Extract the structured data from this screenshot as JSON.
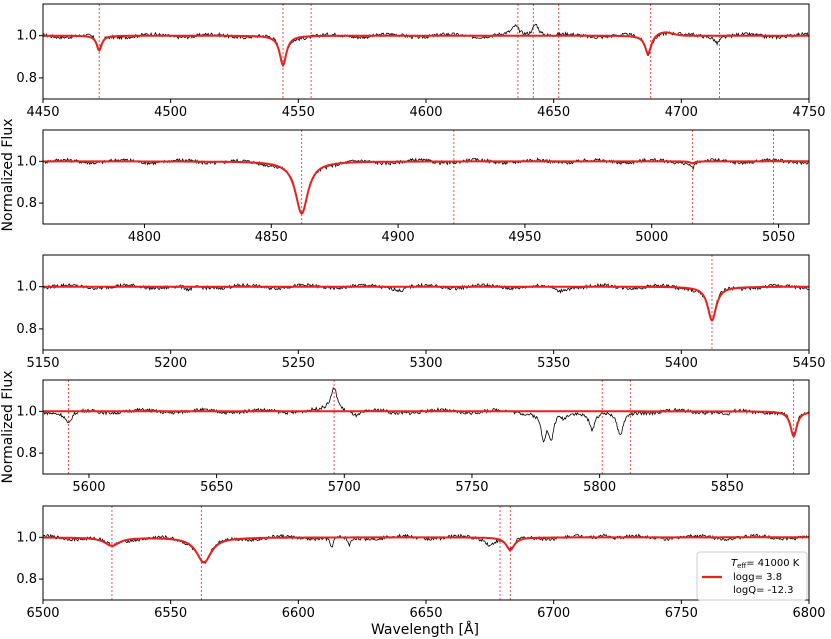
{
  "figure": {
    "ylabel_top": "Normalized Flux",
    "ylabel_bottom": "Normalized Flux",
    "xlabel": "Wavelength [Å]"
  },
  "legend": {
    "teff_label": "T",
    "teff_sub": "eff",
    "teff_value": "= 41000 K",
    "logg": "logg= 3.8",
    "logq": "logQ= -12.3",
    "line_color": "#e8211d"
  },
  "colors": {
    "observed": "#000000",
    "model": "#e8211d",
    "marker": "#e8211d"
  },
  "chart_data": [
    {
      "type": "line",
      "xlim": [
        4450,
        4750
      ],
      "ylim": [
        0.7,
        1.15
      ],
      "xticks": [
        4450,
        4500,
        4550,
        4600,
        4650,
        4700,
        4750
      ],
      "yticks": [
        0.8,
        1.0
      ],
      "xtick_labels": [
        "4450",
        "4500",
        "4550",
        "4600",
        "4650",
        "4700",
        "4750"
      ],
      "ytick_labels": [
        "0.8",
        "1.0"
      ],
      "markers": [
        4472,
        4544,
        4555,
        4636,
        4642,
        4652,
        4688,
        4715
      ],
      "lines": [
        {
          "center": 4472,
          "depth": 0.07,
          "width": 1.2
        },
        {
          "center": 4544,
          "depth": 0.14,
          "width": 1.6
        },
        {
          "center": 4687,
          "depth": 0.09,
          "width": 1.5
        }
      ],
      "emission": [
        {
          "center": 4693,
          "height": 0.02,
          "width": 5
        }
      ],
      "obs_features": [
        {
          "center": 4643,
          "height": 0.06,
          "width": 1.5
        },
        {
          "center": 4635,
          "height": 0.04,
          "width": 1.5
        },
        {
          "center": 4714,
          "depth": 0.03,
          "width": 1.0
        }
      ]
    },
    {
      "type": "line",
      "xlim": [
        4760,
        5062
      ],
      "ylim": [
        0.7,
        1.15
      ],
      "xticks": [
        4800,
        4850,
        4900,
        4950,
        5000,
        5050
      ],
      "yticks": [
        0.8,
        1.0
      ],
      "xtick_labels": [
        "4800",
        "4850",
        "4900",
        "4950",
        "5000",
        "5050"
      ],
      "ytick_labels": [
        "0.8",
        "1.0"
      ],
      "markers": [
        4862,
        4922,
        5016,
        5048
      ],
      "lines": [
        {
          "center": 4862,
          "depth": 0.25,
          "width": 3.0
        },
        {
          "center": 5016,
          "depth": 0.01,
          "width": 1.0
        }
      ],
      "emission": [],
      "obs_features": [
        {
          "center": 5016,
          "depth": 0.02,
          "width": 1.0
        }
      ]
    },
    {
      "type": "line",
      "xlim": [
        5150,
        5450
      ],
      "ylim": [
        0.7,
        1.15
      ],
      "xticks": [
        5150,
        5200,
        5250,
        5300,
        5350,
        5400,
        5450
      ],
      "yticks": [
        0.8,
        1.0
      ],
      "xtick_labels": [
        "5150",
        "5200",
        "5250",
        "5300",
        "5350",
        "5400",
        "5450"
      ],
      "ytick_labels": [
        "0.8",
        "1.0"
      ],
      "markers": [
        5412
      ],
      "lines": [
        {
          "center": 5412,
          "depth": 0.16,
          "width": 2.0
        }
      ],
      "emission": [],
      "obs_features": [
        {
          "center": 5207,
          "depth": 0.02,
          "width": 2.0
        },
        {
          "center": 5290,
          "depth": 0.015,
          "width": 1.5
        },
        {
          "center": 5352,
          "depth": 0.02,
          "width": 2.0
        }
      ]
    },
    {
      "type": "line",
      "xlim": [
        5582,
        5882
      ],
      "ylim": [
        0.7,
        1.15
      ],
      "xticks": [
        5600,
        5650,
        5700,
        5750,
        5800,
        5850
      ],
      "yticks": [
        0.8,
        1.0
      ],
      "xtick_labels": [
        "5600",
        "5650",
        "5700",
        "5750",
        "5800",
        "5850"
      ],
      "ytick_labels": [
        "0.8",
        "1.0"
      ],
      "markers": [
        5592,
        5696,
        5801,
        5812,
        5876
      ],
      "lines": [
        {
          "center": 5876,
          "depth": 0.12,
          "width": 1.5
        }
      ],
      "emission": [],
      "obs_features": [
        {
          "center": 5592,
          "depth": 0.06,
          "width": 1.5
        },
        {
          "center": 5696,
          "height": 0.11,
          "width": 1.6
        },
        {
          "center": 5705,
          "depth": 0.02,
          "width": 1.5
        },
        {
          "center": 5719,
          "depth": 0.01,
          "width": 2.0
        },
        {
          "center": 5778,
          "depth": 0.12,
          "width": 1.2
        },
        {
          "center": 5781,
          "depth": 0.13,
          "width": 1.2
        },
        {
          "center": 5786,
          "depth": 0.03,
          "width": 1.5
        },
        {
          "center": 5797,
          "depth": 0.08,
          "width": 1.2
        },
        {
          "center": 5808,
          "depth": 0.12,
          "width": 1.5
        },
        {
          "center": 5850,
          "depth": 0.02,
          "width": 1.5
        }
      ]
    },
    {
      "type": "line",
      "xlim": [
        6500,
        6800
      ],
      "ylim": [
        0.7,
        1.15
      ],
      "xticks": [
        6500,
        6550,
        6600,
        6650,
        6700,
        6750,
        6800
      ],
      "yticks": [
        0.8,
        1.0
      ],
      "xtick_labels": [
        "6500",
        "6550",
        "6600",
        "6650",
        "6700",
        "6750",
        "6800"
      ],
      "ytick_labels": [
        "0.8",
        "1.0"
      ],
      "markers": [
        6527,
        6562,
        6679,
        6683
      ],
      "lines": [
        {
          "center": 6527,
          "depth": 0.04,
          "width": 3.5
        },
        {
          "center": 6563,
          "depth": 0.12,
          "width": 3.5
        },
        {
          "center": 6683,
          "depth": 0.06,
          "width": 2.0
        }
      ],
      "emission": [],
      "obs_features": [
        {
          "center": 6613,
          "depth": 0.05,
          "width": 0.8
        },
        {
          "center": 6620,
          "depth": 0.04,
          "width": 0.8
        },
        {
          "center": 6675,
          "depth": 0.03,
          "width": 1.5
        },
        {
          "center": 6720,
          "height": 0.02,
          "width": 1.5
        }
      ]
    }
  ]
}
